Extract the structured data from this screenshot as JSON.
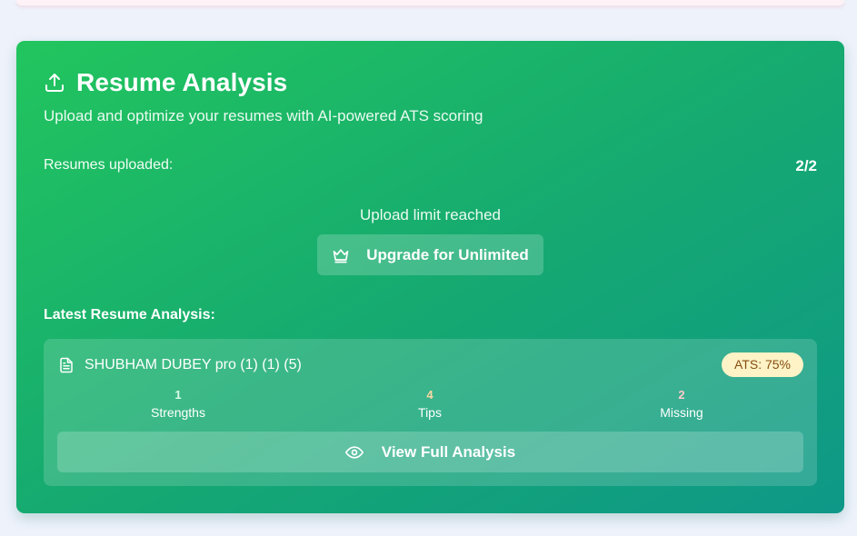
{
  "card": {
    "title": "Resume Analysis",
    "title_icon": "upload-icon",
    "subtitle": "Upload and optimize your resumes with AI-powered ATS scoring",
    "uploads": {
      "label": "Resumes uploaded:",
      "value": "2/2"
    },
    "limit_message": "Upload limit reached",
    "upgrade_button": {
      "label": "Upgrade for Unlimited",
      "icon": "crown-icon"
    },
    "latest_heading": "Latest Resume Analysis:",
    "latest": {
      "file_icon": "file-text-icon",
      "file_name": "SHUBHAM DUBEY pro (1) (1) (5)",
      "ats_badge": "ATS: 75%",
      "stats": [
        {
          "value": "1",
          "label": "Strengths"
        },
        {
          "value": "4",
          "label": "Tips"
        },
        {
          "value": "2",
          "label": "Missing"
        }
      ],
      "view_button": {
        "label": "View Full Analysis",
        "icon": "eye-icon"
      }
    }
  },
  "colors": {
    "gradient_start": "#22c55e",
    "gradient_end": "#0e9888",
    "badge_bg": "#fef3c7",
    "badge_text": "#854d0e"
  }
}
